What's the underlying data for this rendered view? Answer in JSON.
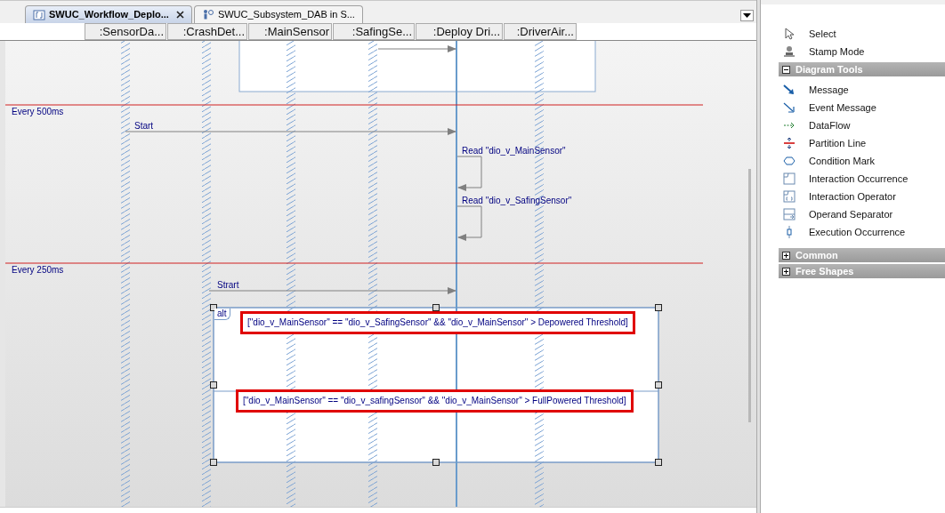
{
  "tabs": [
    {
      "label": "SWUC_Workflow_Deplo...",
      "kind": "workflow",
      "selected": true,
      "closable": true
    },
    {
      "label": "SWUC_Subsystem_DAB in S...",
      "kind": "actor",
      "selected": false,
      "closable": false
    }
  ],
  "lifelines": [
    {
      "label": ":SensorDa..."
    },
    {
      "label": ":CrashDet..."
    },
    {
      "label": ":MainSensor"
    },
    {
      "label": ":SafingSe..."
    },
    {
      "label": ":Deploy Dri..."
    },
    {
      "label": ":DriverAir..."
    }
  ],
  "diagram": {
    "partitions": [
      {
        "label": "Every 500ms"
      },
      {
        "label": "Every 250ms"
      }
    ],
    "messages": [
      {
        "kind": "call",
        "label": "Start"
      },
      {
        "kind": "self",
        "label": "Read \"dio_v_MainSensor\""
      },
      {
        "kind": "self",
        "label": "Read \"dio_v_SafingSensor\""
      },
      {
        "kind": "call",
        "label": "Strart"
      }
    ],
    "fragment": {
      "operator": "alt",
      "selected": true,
      "guards": [
        {
          "text": "[\"dio_v_MainSensor\" == \"dio_v_SafingSensor\" && \"dio_v_MainSensor\" > Depowered Threshold]",
          "highlighted": true
        },
        {
          "text": "[\"dio_v_MainSensor\" == \"dio_v_safingSensor\" && \"dio_v_MainSensor\" > FullPowered Threshold]",
          "highlighted": true
        }
      ]
    }
  },
  "toolbox": {
    "items": [
      {
        "label": "Select",
        "kind": "pointer"
      },
      {
        "label": "Stamp Mode",
        "kind": "stamp"
      }
    ],
    "groups": [
      {
        "label": "Diagram Tools",
        "expanded": true,
        "items": [
          {
            "label": "Message",
            "kind": "message"
          },
          {
            "label": "Event Message",
            "kind": "event"
          },
          {
            "label": "DataFlow",
            "kind": "dataflow"
          },
          {
            "label": "Partition Line",
            "kind": "partition"
          },
          {
            "label": "Condition Mark",
            "kind": "condition"
          },
          {
            "label": "Interaction Occurrence",
            "kind": "occurrence"
          },
          {
            "label": "Interaction Operator",
            "kind": "operator"
          },
          {
            "label": "Operand Separator",
            "kind": "separator"
          },
          {
            "label": "Execution Occurrence",
            "kind": "execution"
          }
        ]
      },
      {
        "label": "Common",
        "expanded": false
      },
      {
        "label": "Free Shapes",
        "expanded": false
      }
    ]
  }
}
